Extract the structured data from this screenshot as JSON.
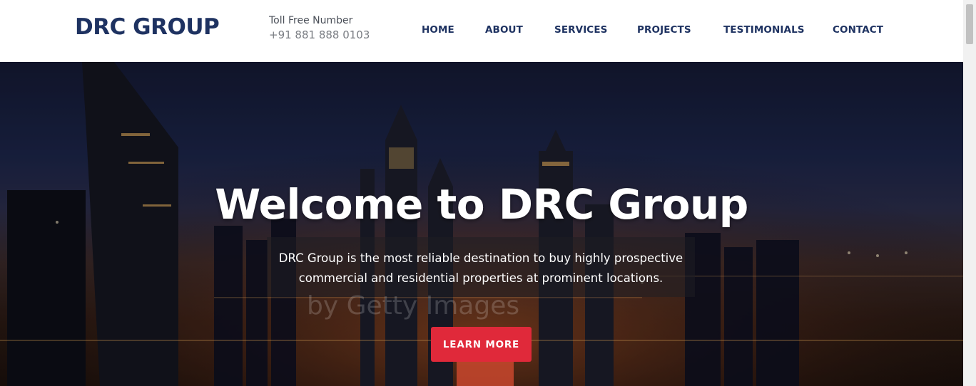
{
  "header": {
    "logo": "DRC GROUP",
    "toll_free_label": "Toll Free Number",
    "toll_free_number": "+91 881 888 0103"
  },
  "nav": {
    "items": [
      {
        "label": "HOME"
      },
      {
        "label": "ABOUT"
      },
      {
        "label": "SERVICES"
      },
      {
        "label": "PROJECTS"
      },
      {
        "label": "TESTIMONIALS"
      },
      {
        "label": "CONTACT"
      }
    ]
  },
  "hero": {
    "title": "Welcome to DRC Group",
    "subtitle": "DRC Group is the most reliable destination to buy highly prospective commercial and residential properties at prominent locations.",
    "watermark": "by Getty Images",
    "cta_label": "LEARN MORE"
  },
  "colors": {
    "brand": "#1e3261",
    "cta": "#e0293a"
  }
}
